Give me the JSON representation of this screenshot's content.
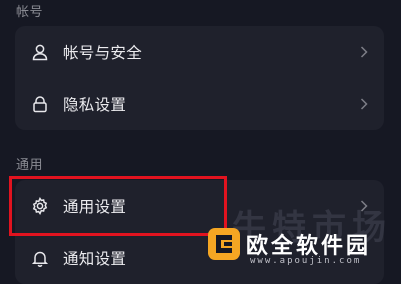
{
  "sections": {
    "account_label": "帐号",
    "general_label": "通用"
  },
  "items": {
    "account_security": {
      "label": "帐号与安全",
      "icon": "user-icon"
    },
    "privacy": {
      "label": "隐私设置",
      "icon": "lock-icon"
    },
    "general_settings": {
      "label": "通用设置",
      "icon": "gear-icon"
    },
    "notification": {
      "label": "通知设置",
      "icon": "bell-icon"
    }
  },
  "watermark": {
    "background_text": "牛特市场",
    "title": "欧全软件园",
    "url": "www.apoujin.com"
  },
  "colors": {
    "background": "#161823",
    "card": "#1f212c",
    "highlight": "#e1131f",
    "watermark_orange": "#f5a623"
  }
}
